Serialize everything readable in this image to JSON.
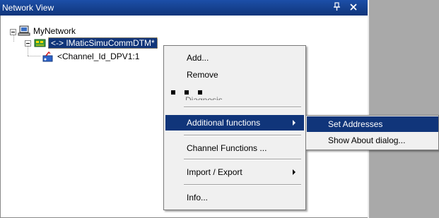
{
  "window": {
    "title": "Network View"
  },
  "tree": {
    "root": {
      "label": "MyNetwork",
      "icon": "network-computer-icon"
    },
    "children": [
      {
        "label": "<-> IMaticSimuCommDTM*",
        "icon": "dtm-device-icon",
        "selected": true
      },
      {
        "label": "<Channel_Id_DPV1:1",
        "icon": "channel-icon",
        "selected": false
      }
    ]
  },
  "context_menu": {
    "items": [
      {
        "label": "Add..."
      },
      {
        "label": "Remove"
      },
      {
        "label": "Diagnosis"
      },
      {
        "label": "Additional functions",
        "has_submenu": true,
        "active": true
      },
      {
        "label": "Channel Functions ..."
      },
      {
        "label": "Import / Export",
        "has_submenu": true
      },
      {
        "label": "Info..."
      }
    ]
  },
  "submenu": {
    "items": [
      {
        "label": "Set Addresses",
        "active": true
      },
      {
        "label": "Show About dialog..."
      }
    ]
  },
  "colors": {
    "titlebar": "#10357a",
    "selection": "#10357a",
    "menu_bg": "#f0f0f0",
    "right_pane": "#a9a9a9"
  }
}
